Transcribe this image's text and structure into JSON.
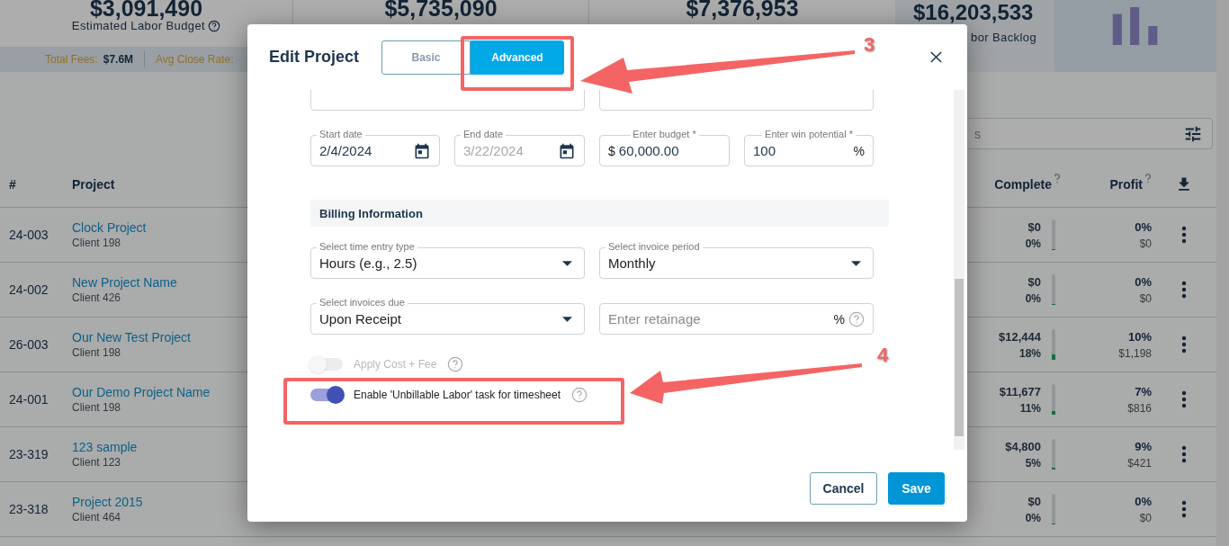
{
  "stats": [
    {
      "value": "$3,091,490",
      "label": "Estimated Labor Budget"
    },
    {
      "value": "$5,735,090"
    },
    {
      "value": "$7,376,953"
    }
  ],
  "summary": [
    {
      "label": "Total Fees:",
      "value": "$7.6M"
    },
    {
      "label": "Avg Close Rate:"
    }
  ],
  "backlog": {
    "value": "$16,203,533",
    "label": "bor Backlog"
  },
  "search": {
    "placeholder": "s"
  },
  "table": {
    "columns": [
      "#",
      "Project",
      "Complete",
      "Profit"
    ],
    "rows": [
      {
        "id": "24-003",
        "name": "Clock Project",
        "client": "Client 198",
        "complete_amount": "$0",
        "complete_pct": "0%",
        "level": 0,
        "profit_pct": "0%",
        "profit_amount": "$0"
      },
      {
        "id": "24-002",
        "name": "New Project Name",
        "client": "Client 426",
        "complete_amount": "$0",
        "complete_pct": "0%",
        "level": 0,
        "profit_pct": "0%",
        "profit_amount": "$0"
      },
      {
        "id": "26-003",
        "name": "Our New Test Project",
        "client": "Client 198",
        "complete_amount": "$12,444",
        "complete_pct": "18%",
        "level": 0.18,
        "profit_pct": "10%",
        "profit_amount": "$1,198"
      },
      {
        "id": "24-001",
        "name": "Our Demo Project Name",
        "client": "Client 198",
        "complete_amount": "$11,677",
        "complete_pct": "11%",
        "level": 0.11,
        "profit_pct": "7%",
        "profit_amount": "$816"
      },
      {
        "id": "23-319",
        "name": "123 sample",
        "client": "Client 123",
        "complete_amount": "$4,800",
        "complete_pct": "5%",
        "level": 0.05,
        "profit_pct": "9%",
        "profit_amount": "$421"
      },
      {
        "id": "23-318",
        "name": "Project 2015",
        "client": "Client 464",
        "complete_amount": "$0",
        "complete_pct": "0%",
        "level": 0,
        "profit_pct": "0%",
        "profit_amount": "$0"
      }
    ]
  },
  "modal": {
    "title": "Edit Project",
    "tabs": [
      {
        "label": "Basic",
        "selected": false
      },
      {
        "label": "Advanced",
        "selected": true
      }
    ],
    "date_fields": [
      {
        "kind": "date",
        "label": "Start date",
        "value": "2/4/2024",
        "disabled": false
      },
      {
        "kind": "date",
        "label": "End date",
        "value": "3/22/2024",
        "disabled": true
      },
      {
        "kind": "prefix",
        "label": "Enter budget *",
        "prefix": "$",
        "value": "60,000.00",
        "disabled": false
      },
      {
        "kind": "suffix",
        "label": "Enter win potential *",
        "value": "100",
        "suffix": "%",
        "disabled": false
      }
    ],
    "section_title": "Billing Information",
    "billing_fields": [
      {
        "kind": "select",
        "label": "Select time entry type",
        "value": "Hours (e.g., 2.5)",
        "help": false
      },
      {
        "kind": "select",
        "label": "Select invoice period",
        "value": "Monthly",
        "help": false
      },
      {
        "kind": "select",
        "label": "Select invoices due",
        "value": "Upon Receipt",
        "help": false
      },
      {
        "kind": "suffix",
        "placeholder": "Enter retainage",
        "suffix": "%",
        "help": true
      }
    ],
    "toggles": [
      {
        "label": "Apply Cost + Fee",
        "on": false,
        "disabled": true
      },
      {
        "label": "Enable 'Unbillable Labor' task for timesheet",
        "on": true,
        "disabled": false
      }
    ],
    "buttons": [
      {
        "label": "Cancel",
        "kind": "secondary"
      },
      {
        "label": "Save",
        "kind": "primary"
      }
    ]
  },
  "annotations": [
    {
      "number": "3"
    },
    {
      "number": "4"
    }
  ]
}
